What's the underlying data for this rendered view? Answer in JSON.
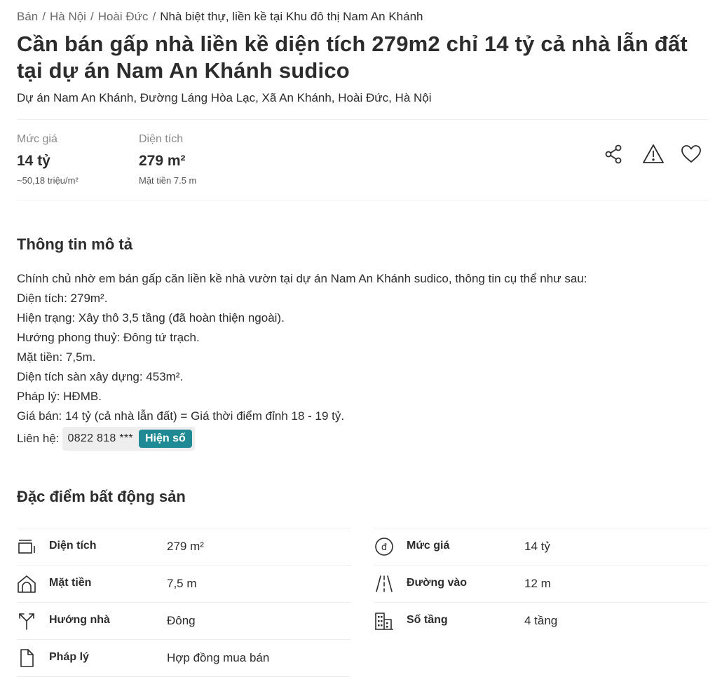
{
  "breadcrumb": {
    "items": [
      "Bán",
      "Hà Nội",
      "Hoài Đức"
    ],
    "current": "Nhà biệt thự, liền kề tại Khu đô thị Nam An Khánh"
  },
  "listing": {
    "title": "Cần bán gấp nhà liền kề diện tích 279m2 chỉ 14 tỷ cả nhà lẫn đất tại dự án Nam An Khánh sudico",
    "address": "Dự án Nam An Khánh, Đường Láng Hòa Lạc, Xã An Khánh, Hoài Đức, Hà Nội"
  },
  "stats": {
    "price_label": "Mức giá",
    "price_value": "14 tỷ",
    "price_sub": "~50,18 triệu/m²",
    "area_label": "Diện tích",
    "area_value": "279 m²",
    "area_sub": "Mặt tiền 7.5 m"
  },
  "actions": {
    "share_icon": "share-icon",
    "report_icon": "warning-icon",
    "save_icon": "heart-icon"
  },
  "description": {
    "heading": "Thông tin mô tả",
    "lines": [
      "Chính chủ nhờ em bán gấp căn liền kề nhà vườn tại dự án Nam An Khánh sudico, thông tin cụ thể như sau:",
      "Diện tích: 279m².",
      "Hiện trạng: Xây thô 3,5 tầng (đã hoàn thiện ngoài).",
      "Hướng phong thuỷ: Đông tứ trạch.",
      "Mặt tiền: 7,5m.",
      "Diện tích sàn xây dựng: 453m².",
      "Pháp lý: HĐMB.",
      "Giá bán: 14 tỷ (cả nhà lẫn đất) = Giá thời điểm đỉnh 18 - 19 tỷ."
    ],
    "contact_label": "Liên hệ:",
    "phone_masked": "0822 818 ***",
    "reveal_button": "Hiện số"
  },
  "features": {
    "heading": "Đặc điểm bất động sản",
    "left": [
      {
        "icon": "area-icon",
        "label": "Diện tích",
        "value": "279 m²"
      },
      {
        "icon": "house-front-icon",
        "label": "Mặt tiền",
        "value": "7,5 m"
      },
      {
        "icon": "direction-icon",
        "label": "Hướng nhà",
        "value": "Đông"
      },
      {
        "icon": "document-icon",
        "label": "Pháp lý",
        "value": "Hợp đồng mua bán"
      }
    ],
    "right": [
      {
        "icon": "dong-currency-icon",
        "label": "Mức giá",
        "value": "14 tỷ"
      },
      {
        "icon": "road-icon",
        "label": "Đường vào",
        "value": "12 m"
      },
      {
        "icon": "building-icon",
        "label": "Số tầng",
        "value": "4 tầng"
      }
    ]
  }
}
